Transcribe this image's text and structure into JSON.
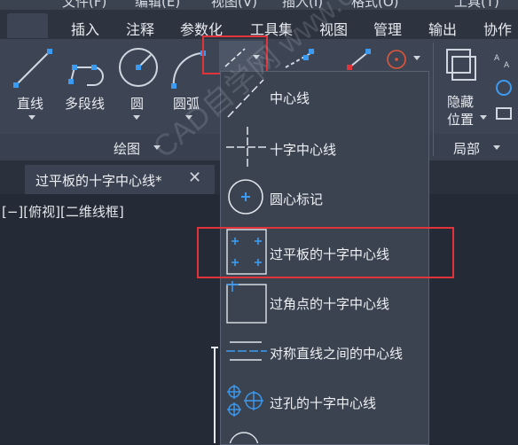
{
  "menubar": {
    "items": [
      "文件(F)",
      "编辑(E)",
      "视图(V)",
      "插入(I)",
      "格式(O)",
      "工具(T)"
    ]
  },
  "ribbon_tabs": {
    "items": [
      "插入",
      "注释",
      "参数化",
      "工具集",
      "视图",
      "管理",
      "输出",
      "协作"
    ]
  },
  "draw_panel": {
    "tools": [
      "直线",
      "多段线",
      "圆",
      "圆弧"
    ],
    "panel_title": "绘图"
  },
  "layers_panel": {
    "hide_label_line1": "隐藏",
    "hide_label_line2": "位置",
    "panel_title": "局部"
  },
  "file_tab": {
    "title": "过平板的十字中心线*",
    "close": "✕"
  },
  "viewport": {
    "label": "[−][俯视][二维线框]"
  },
  "dropdown_menu": {
    "items": [
      {
        "label": "中心线",
        "icon": "centerline-icon"
      },
      {
        "label": "十字中心线",
        "icon": "cross-centerline-icon"
      },
      {
        "label": "圆心标记",
        "icon": "center-mark-icon"
      },
      {
        "label": "过平板的十字中心线",
        "icon": "plate-cross-centerline-icon"
      },
      {
        "label": "过角点的十字中心线",
        "icon": "corner-cross-centerline-icon"
      },
      {
        "label": "对称直线之间的中心线",
        "icon": "symmetric-centerline-icon"
      },
      {
        "label": "过孔的十字中心线",
        "icon": "hole-cross-centerline-icon"
      }
    ]
  },
  "watermark": {
    "text": "CAD自学网 www.cadzxw.com"
  },
  "colors": {
    "accent_blue": "#3c9bf0",
    "highlight_red": "#e0343a",
    "menu_bg": "#3b4350"
  }
}
